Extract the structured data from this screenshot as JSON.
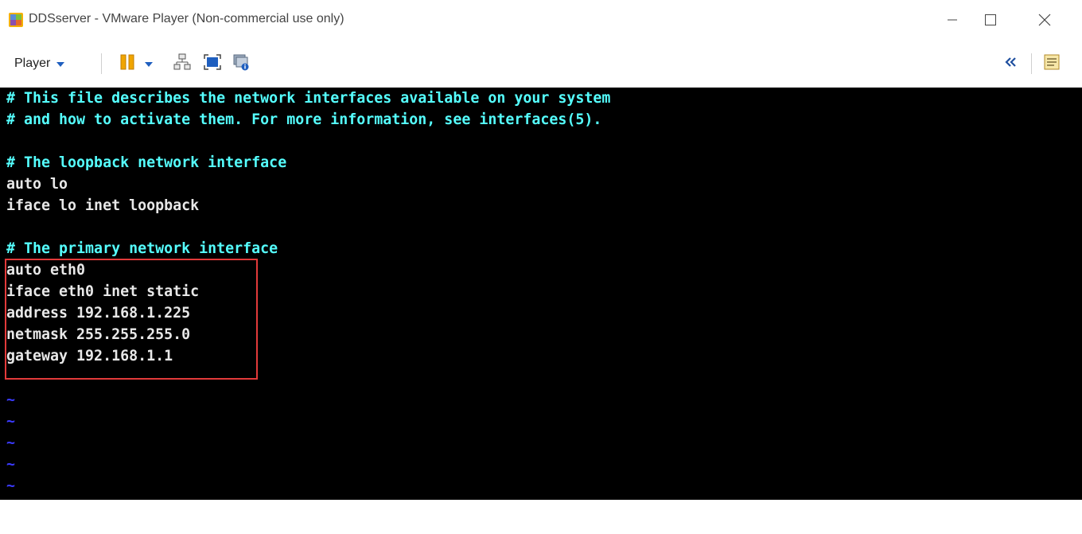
{
  "window": {
    "title": "DDSserver - VMware Player (Non-commercial use only)",
    "icon": "vmware-player-icon",
    "controls": [
      "minimize-icon",
      "maximize-icon",
      "close-icon"
    ]
  },
  "toolbar": {
    "player_label": "Player",
    "icons": [
      "pause-icon",
      "chevron-down-icon",
      "network-icon",
      "fullscreen-icon",
      "unity-icon",
      "collapse-icon",
      "library-icon"
    ]
  },
  "terminal": {
    "lines": [
      "# This file describes the network interfaces available on your system",
      "# and how to activate them. For more information, see interfaces(5).",
      "",
      "# The loopback network interface",
      "auto lo",
      "iface lo inet loopback",
      "",
      "# The primary network interface",
      "auto eth0",
      "iface eth0 inet static",
      "address 192.168.1.225",
      "netmask 255.255.255.0",
      "gateway 192.168.1.1",
      "~",
      "~",
      "~",
      "~",
      "~"
    ]
  },
  "colors": {
    "comment": "#55ffff",
    "text": "#e8e8e8",
    "tilde": "#3a3aff",
    "highlight": "#e23a3a",
    "background": "#000000",
    "toolbar_accent": "#f0a500"
  }
}
